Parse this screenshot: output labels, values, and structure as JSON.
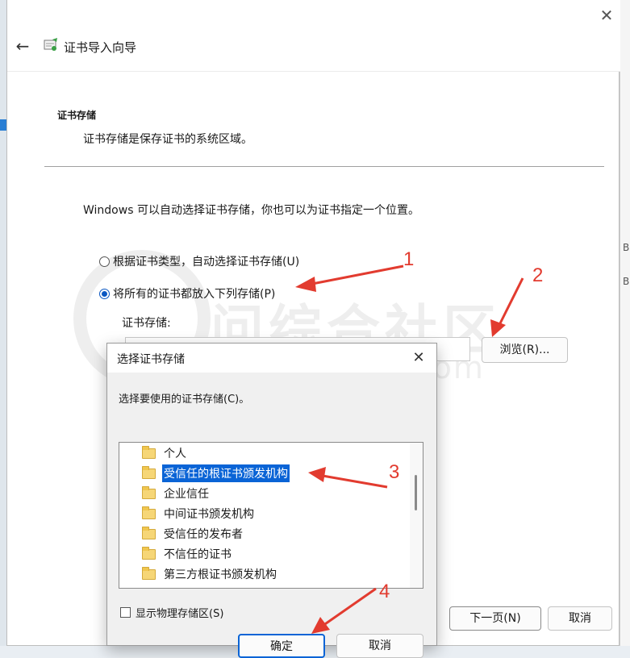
{
  "background": {
    "right_edge_letters": [
      "B",
      "B"
    ]
  },
  "wizard": {
    "title": "证书导入向导",
    "section_title": "证书存储",
    "section_desc": "证书存储是保存证书的系统区域。",
    "body_text": "Windows 可以自动选择证书存储，你也可以为证书指定一个位置。",
    "radio_auto": "根据证书类型，自动选择证书存储(U)",
    "radio_manual": "将所有的证书都放入下列存储(P)",
    "store_label": "证书存储:",
    "store_value": "",
    "browse_label": "浏览(R)...",
    "next_label": "下一页(N)",
    "cancel_label": "取消"
  },
  "watermark": {
    "text": "问综合社区",
    "url": "www.i3zh.com"
  },
  "dialog": {
    "title": "选择证书存储",
    "description": "选择要使用的证书存储(C)。",
    "tree_items": [
      {
        "label": "个人",
        "selected": false
      },
      {
        "label": "受信任的根证书颁发机构",
        "selected": true
      },
      {
        "label": "企业信任",
        "selected": false
      },
      {
        "label": "中间证书颁发机构",
        "selected": false
      },
      {
        "label": "受信任的发布者",
        "selected": false
      },
      {
        "label": "不信任的证书",
        "selected": false
      },
      {
        "label": "第三方根证书颁发机构",
        "selected": false
      }
    ],
    "show_physical_label": "显示物理存储区(S)",
    "ok_label": "确定",
    "cancel_label": "取消"
  },
  "annotations": {
    "steps": [
      "1",
      "2",
      "3",
      "4"
    ],
    "color": "#e23b2f"
  },
  "colors": {
    "accent": "#0a64d6",
    "arrow": "#e23b2f"
  }
}
